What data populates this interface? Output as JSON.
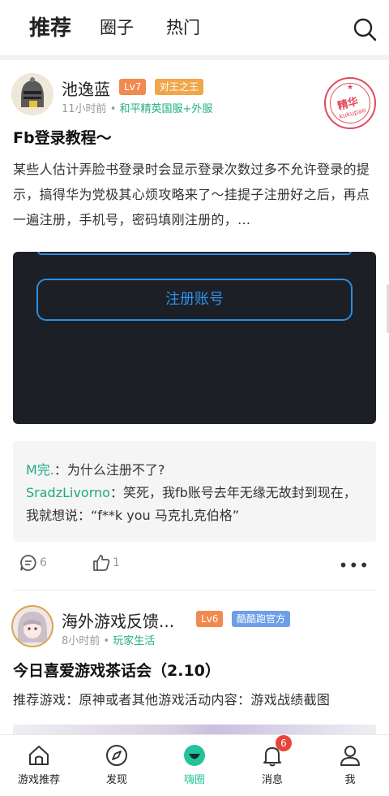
{
  "tabs": [
    {
      "label": "推荐"
    },
    {
      "label": "圈子"
    },
    {
      "label": "热门"
    }
  ],
  "posts": [
    {
      "author": "池逸蓝",
      "level": "Lv7",
      "title_badge": "对王之王",
      "time": "11小时前",
      "topic": "和平精英国服+外服",
      "stamp": {
        "main": "精华",
        "sub": "kukupao"
      },
      "title": "Fb登录教程～",
      "body": "某些人估计弄脸书登录时会显示登录次数过多不允许登录的提示，搞得华为党极其心烦攻略来了～挂提子注册好之后，再点一遍注册，手机号，密码填刚注册的，...",
      "image_button": "注册账号",
      "comments": [
        {
          "who": "M完.",
          "sep": "：",
          "text": "为什么注册不了?"
        },
        {
          "who": "SradzLivorno",
          "sep": "：",
          "text": "笑死，我fb账号去年无缘无故封到现在，我就想说：“f**k you 马克扎克伯格”"
        }
      ],
      "comment_count": "6",
      "like_count": "1",
      "more": "•••"
    },
    {
      "author": "海外游戏反馈...",
      "level": "Lv6",
      "title_badge": "酷酷跑官方",
      "time": "8小时前",
      "topic": "玩家生活",
      "title": "今日喜爱游戏茶话会（2.10）",
      "body": "推荐游戏：原神或者其他游戏活动内容：游戏战绩截图"
    }
  ],
  "nav": [
    {
      "label": "游戏推荐",
      "icon": "home-icon"
    },
    {
      "label": "发现",
      "icon": "compass-icon"
    },
    {
      "label": "嗨圈",
      "icon": "circle-smile-icon"
    },
    {
      "label": "消息",
      "icon": "bell-icon"
    },
    {
      "label": "我",
      "icon": "person-icon"
    }
  ],
  "notification_count": "6",
  "colors": {
    "accent": "#21c49a",
    "topic": "#21b07a",
    "lv7": "#f2894f",
    "king": "#f0a64a",
    "lv6": "#f2894f",
    "official": "#6d9fe8",
    "stamp": "#e04a5a",
    "badge": "#e8443a"
  }
}
